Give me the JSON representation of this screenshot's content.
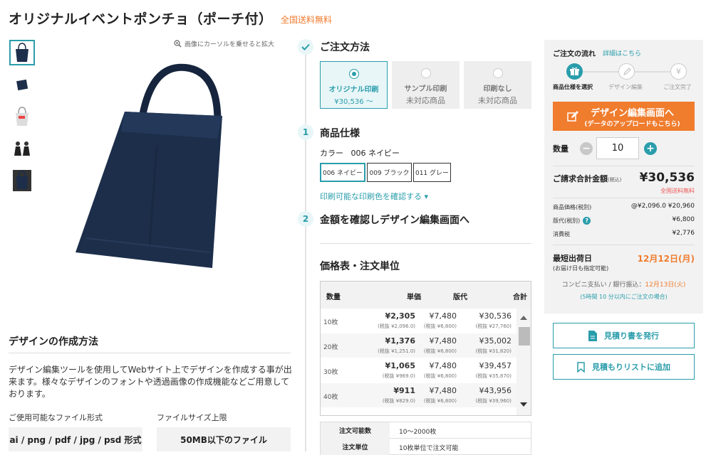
{
  "product": {
    "title": "オリジナルイベントポンチョ（ポーチ付）",
    "shipping_badge": "全国送料無料",
    "zoom_hint": "画像にカーソルを乗せると拡大"
  },
  "design_method": {
    "title": "デザインの作成方法",
    "text": "デザイン編集ツールを使用してWebサイト上でデザインを作成する事が出来ます。様々なデザインのフォントや透過画像の作成機能などご用意しております。",
    "file_format_label": "ご使用可能なファイル形式",
    "file_format_value": "ai / png / pdf / jpg / psd 形式",
    "file_size_label": "ファイルサイズ上限",
    "file_size_value": "50MB以下のファイル"
  },
  "order_method": {
    "title": "ご注文方法",
    "options": [
      {
        "label": "オリジナル印刷",
        "sub": "¥30,536 ～"
      },
      {
        "label": "サンプル印刷",
        "sub": "未対応商品"
      },
      {
        "label": "印刷なし",
        "sub": "未対応商品"
      }
    ]
  },
  "spec": {
    "step": "1",
    "title": "商品仕様",
    "color_label": "カラー",
    "color_value": "006 ネイビー",
    "colors": [
      "006 ネイビー",
      "009 ブラック",
      "011 グレー"
    ],
    "print_color_link": "印刷可能な印刷色を確認する ▾"
  },
  "step2": {
    "step": "2",
    "title": "金額を確認しデザイン編集画面へ"
  },
  "price_table": {
    "title": "価格表・注文単位",
    "headers": [
      "数量",
      "単価",
      "版代",
      "合計"
    ],
    "rows": [
      {
        "qty": "10枚",
        "unit": "¥2,305",
        "unit_sub": "(税抜 ¥2,096.0)",
        "plate": "¥7,480",
        "plate_sub": "(税抜 ¥6,800)",
        "total": "¥30,536",
        "total_sub": "(税抜 ¥27,760)"
      },
      {
        "qty": "20枚",
        "unit": "¥1,376",
        "unit_sub": "(税抜 ¥1,251.0)",
        "plate": "¥7,480",
        "plate_sub": "(税抜 ¥6,800)",
        "total": "¥35,002",
        "total_sub": "(税抜 ¥31,820)"
      },
      {
        "qty": "30枚",
        "unit": "¥1,065",
        "unit_sub": "(税抜 ¥969.0)",
        "plate": "¥7,480",
        "plate_sub": "(税抜 ¥6,800)",
        "total": "¥39,457",
        "total_sub": "(税抜 ¥35,870)"
      },
      {
        "qty": "40枚",
        "unit": "¥911",
        "unit_sub": "(税抜 ¥829.0)",
        "plate": "¥7,480",
        "plate_sub": "(税抜 ¥6,800)",
        "total": "¥43,956",
        "total_sub": "(税抜 ¥39,960)"
      }
    ]
  },
  "limits": [
    {
      "label": "注文可能数",
      "value": "10～2000枚"
    },
    {
      "label": "注文単位",
      "value": "10枚単位で注文可能"
    }
  ],
  "flow": {
    "title": "ご注文の流れ",
    "link": "詳細はこちら",
    "steps": [
      "商品仕様を選択",
      "デザイン編集",
      "ご注文完了"
    ]
  },
  "design_button": {
    "main": "デザイン編集画面へ",
    "sub": "(データのアップロードもこちら)"
  },
  "quantity": {
    "label": "数量",
    "value": "10"
  },
  "total": {
    "label": "ご請求合計金額",
    "tax_note": "(税込)",
    "price": "¥30,536",
    "free_shipping": "全国送料無料"
  },
  "breakdown": [
    {
      "label": "商品価格(税別)",
      "value": "@¥2,096.0 ¥20,960"
    },
    {
      "label": "版代(税別)",
      "value": "¥6,800"
    },
    {
      "label": "消費税",
      "value": "¥2,776"
    }
  ],
  "shipping": {
    "label": "最短出荷日",
    "sub": "(お届け日も指定可能)",
    "date": "12月12日(月)",
    "conv_prefix": "コンビニ支払い / 銀行振込：",
    "conv_date": "12月13日(火)",
    "note": "(5時間 10 分以内にご注文の場合)"
  },
  "actions": {
    "estimate": "見積り書を発行",
    "add_list": "見積もりリストに追加"
  },
  "colors": {
    "accent": "#2a9dab",
    "orange": "#f07c2e",
    "navy": "#1c2e4a"
  }
}
